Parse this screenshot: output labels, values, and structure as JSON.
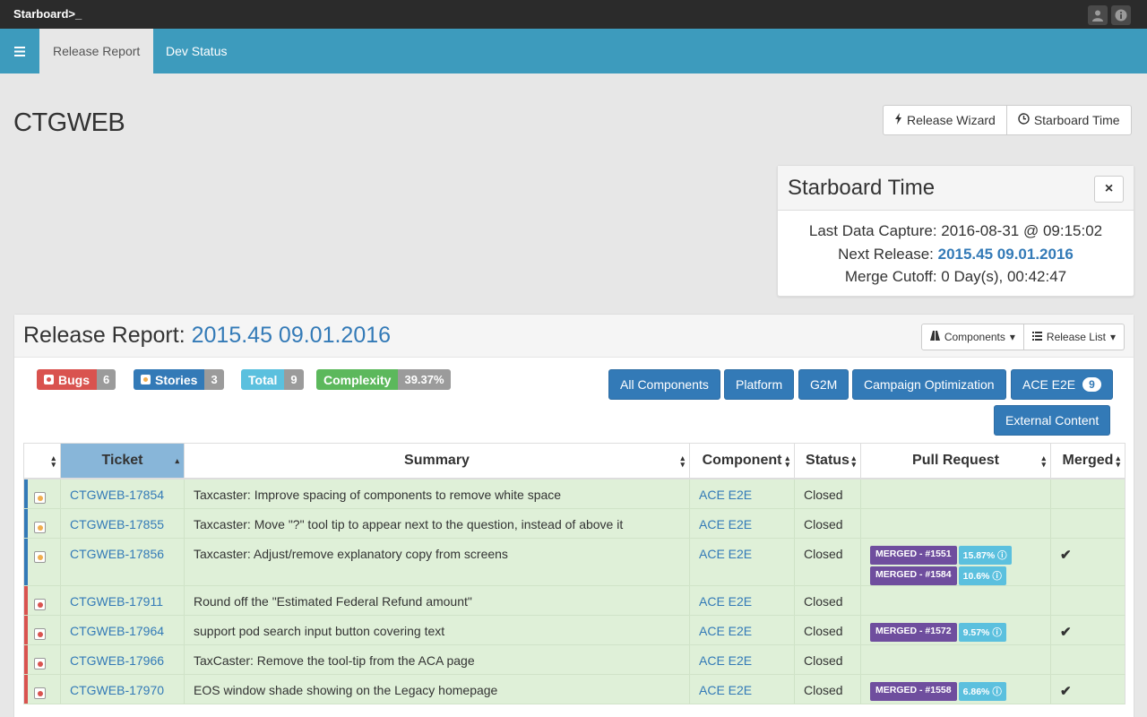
{
  "app": {
    "brand": "Starboard>_",
    "user_icon": "user-icon",
    "info_icon": "info-icon"
  },
  "nav": {
    "menu_icon": "menu-icon",
    "tabs": [
      {
        "label": "Release Report",
        "active": true
      },
      {
        "label": "Dev Status",
        "active": false
      }
    ]
  },
  "page": {
    "title": "CTGWEB"
  },
  "header_buttons": {
    "release_wizard": "Release Wizard",
    "starboard_time": "Starboard Time"
  },
  "starboard_time": {
    "title": "Starboard Time",
    "close": "×",
    "last_capture_label": "Last Data Capture: ",
    "last_capture_value": "2016-08-31 @ 09:15:02",
    "next_release_label": "Next Release: ",
    "next_release_value": "2015.45 09.01.2016",
    "merge_cutoff_label": "Merge Cutoff: ",
    "merge_cutoff_value": "0 Day(s), 00:42:47"
  },
  "report": {
    "title_prefix": "Release Report: ",
    "title_release": "2015.45 09.01.2016",
    "components_btn": "Components",
    "release_list_btn": "Release List",
    "labels": {
      "bugs": {
        "label": "Bugs",
        "count": "6",
        "color": "#d9534f"
      },
      "stories": {
        "label": "Stories",
        "count": "3",
        "color": "#337ab7"
      },
      "total": {
        "label": "Total",
        "count": "9",
        "color": "#5bc0de"
      },
      "complexity": {
        "label": "Complexity",
        "count": "39.37%",
        "color": "#5cb85c"
      }
    },
    "component_buttons": {
      "all": "All Components",
      "platform": "Platform",
      "g2m": "G2M",
      "campaign": "Campaign Optimization",
      "ace": "ACE E2E",
      "ace_badge": "9",
      "external": "External Content"
    },
    "columns": {
      "ticket": "Ticket",
      "summary": "Summary",
      "component": "Component",
      "status": "Status",
      "pull_request": "Pull Request",
      "merged": "Merged"
    },
    "rows": [
      {
        "type": "story",
        "ticket": "CTGWEB-17854",
        "summary": "Taxcaster: Improve spacing of components to remove white space",
        "component": "ACE E2E",
        "status": "Closed"
      },
      {
        "type": "story",
        "ticket": "CTGWEB-17855",
        "summary": "Taxcaster: Move \"?\" tool tip to appear next to the question, instead of above it",
        "component": "ACE E2E",
        "status": "Closed"
      },
      {
        "type": "story",
        "ticket": "CTGWEB-17856",
        "summary": "Taxcaster: Adjust/remove explanatory copy from screens",
        "component": "ACE E2E",
        "status": "Closed",
        "prs": [
          {
            "merged": "MERGED - #1551",
            "pct": "15.87% ⓘ"
          },
          {
            "merged": "MERGED - #1584",
            "pct": "10.6% ⓘ"
          }
        ],
        "merged_mark": "✔"
      },
      {
        "type": "bug",
        "ticket": "CTGWEB-17911",
        "summary": "Round off the \"Estimated Federal Refund amount\"",
        "component": "ACE E2E",
        "status": "Closed"
      },
      {
        "type": "bug",
        "ticket": "CTGWEB-17964",
        "summary": "support pod search input button covering text",
        "component": "ACE E2E",
        "status": "Closed",
        "prs": [
          {
            "merged": "MERGED - #1572",
            "pct": "9.57% ⓘ"
          }
        ],
        "merged_mark": "✔"
      },
      {
        "type": "bug",
        "ticket": "CTGWEB-17966",
        "summary": "TaxCaster: Remove the tool-tip from the ACA page",
        "component": "ACE E2E",
        "status": "Closed"
      },
      {
        "type": "bug",
        "ticket": "CTGWEB-17970",
        "summary": "EOS window shade showing on the Legacy homepage",
        "component": "ACE E2E",
        "status": "Closed",
        "prs": [
          {
            "merged": "MERGED - #1558",
            "pct": "6.86% ⓘ"
          }
        ],
        "merged_mark": "✔"
      }
    ]
  }
}
